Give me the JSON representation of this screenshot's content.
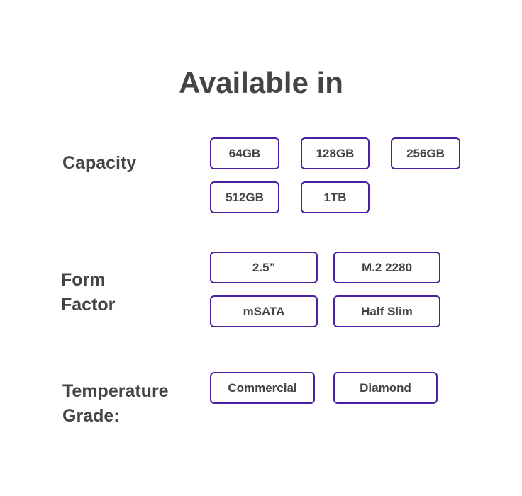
{
  "title": "Available in",
  "accent_color": "#4a1fa0",
  "sections": {
    "capacity": {
      "label": "Capacity",
      "options": [
        "64GB",
        "128GB",
        "256GB",
        "512GB",
        "1TB"
      ]
    },
    "form_factor": {
      "label_line1": "Form",
      "label_line2": "Factor",
      "options": [
        "2.5”",
        "M.2 2280",
        "mSATA",
        "Half Slim"
      ]
    },
    "temperature_grade": {
      "label_line1": "Temperature",
      "label_line2": "Grade:",
      "options": [
        "Commercial",
        "Diamond"
      ]
    }
  }
}
